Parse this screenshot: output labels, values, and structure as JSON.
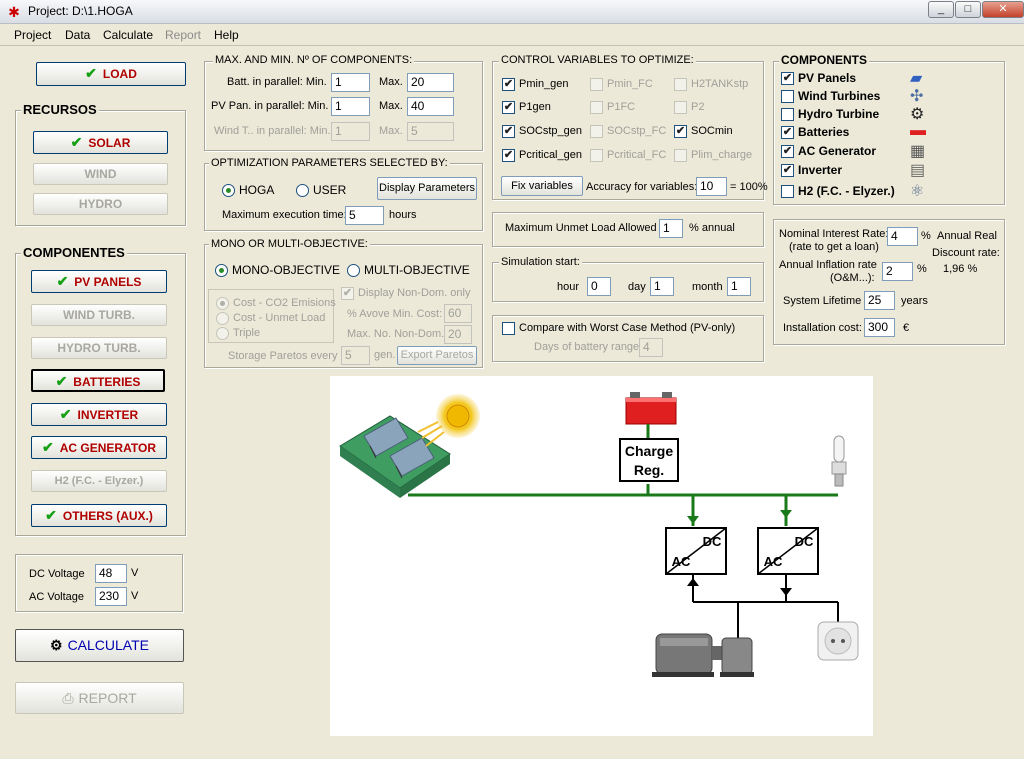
{
  "window": {
    "title": "Project: D:\\1.HOGA",
    "min": "_",
    "max": "□",
    "close": "✕"
  },
  "menu": [
    "Project",
    "Data",
    "Calculate",
    "Report",
    "Help"
  ],
  "left": {
    "load": "LOAD",
    "recursos_title": "RECURSOS",
    "recursos": [
      "SOLAR",
      "WIND",
      "HYDRO"
    ],
    "componentes_title": "COMPONENTES",
    "componentes": [
      "PV PANELS",
      "WIND TURB.",
      "HYDRO TURB.",
      "BATTERIES",
      "INVERTER",
      "AC GENERATOR",
      "H2 (F.C. - Elyzer.)",
      "OTHERS (AUX.)"
    ],
    "dc_voltage_label": "DC Voltage",
    "dc_voltage": "48",
    "dc_unit": "V",
    "ac_voltage_label": "AC Voltage",
    "ac_voltage": "230",
    "ac_unit": "V",
    "calculate": "CALCULATE",
    "report": "REPORT"
  },
  "maxmin": {
    "title": "MAX. AND MIN. Nº OF COMPONENTS:",
    "batt_label": "Batt. in parallel: Min.",
    "batt_min": "1",
    "batt_max": "20",
    "pv_label": "PV Pan. in parallel: Min.",
    "pv_min": "1",
    "pv_max": "40",
    "wind_label": "Wind T.. in parallel: Min.",
    "wind_min": "1",
    "wind_max": "5",
    "max_label": "Max."
  },
  "optim": {
    "title": "OPTIMIZATION PARAMETERS SELECTED BY:",
    "hoga": "HOGA",
    "user": "USER",
    "display_params": "Display Parameters",
    "max_exec_label": "Maximum execution time:",
    "max_exec": "5",
    "hours": "hours"
  },
  "mono": {
    "title": "MONO OR MULTI-OBJECTIVE:",
    "mono": "MONO-OBJECTIVE",
    "multi": "MULTI-OBJECTIVE",
    "opts": [
      "Cost - CO2 Emisions",
      "Cost - Unmet Load",
      "Triple"
    ],
    "display_nondom": "Display Non-Dom. only",
    "avove_label": "% Avove Min. Cost:",
    "avove": "60",
    "maxnondom_label": "Max. No. Non-Dom.:",
    "maxnondom": "20",
    "storage_label": "Storage Paretos every",
    "storage": "5",
    "gen": "gen.",
    "export": "Export Paretos"
  },
  "control": {
    "title": "CONTROL VARIABLES TO OPTIMIZE:",
    "vars": [
      {
        "label": "Pmin_gen",
        "checked": true,
        "enabled": true
      },
      {
        "label": "Pmin_FC",
        "checked": false,
        "enabled": false
      },
      {
        "label": "H2TANKstp",
        "checked": false,
        "enabled": false
      },
      {
        "label": "P1gen",
        "checked": true,
        "enabled": true
      },
      {
        "label": "P1FC",
        "checked": false,
        "enabled": false
      },
      {
        "label": "P2",
        "checked": false,
        "enabled": false
      },
      {
        "label": "SOCstp_gen",
        "checked": true,
        "enabled": true
      },
      {
        "label": "SOCstp_FC",
        "checked": false,
        "enabled": false
      },
      {
        "label": "SOCmin",
        "checked": true,
        "enabled": true
      },
      {
        "label": "Pcritical_gen",
        "checked": true,
        "enabled": true
      },
      {
        "label": "Pcritical_FC",
        "checked": false,
        "enabled": false
      },
      {
        "label": "Plim_charge",
        "checked": false,
        "enabled": false
      }
    ],
    "fix": "Fix variables",
    "accuracy_label": "Accuracy for variables:",
    "accuracy": "10",
    "accuracy_unit": "= 100%"
  },
  "unmet": {
    "label": "Maximum Unmet Load Allowed",
    "value": "1",
    "unit": "% annual"
  },
  "sim": {
    "title": "Simulation start:",
    "hour_label": "hour",
    "hour": "0",
    "day_label": "day",
    "day": "1",
    "month_label": "month",
    "month": "1"
  },
  "compare": {
    "label": "Compare with Worst Case Method (PV-only)",
    "days_label": "Days of battery range",
    "days": "4"
  },
  "components": {
    "title": "COMPONENTS",
    "items": [
      {
        "label": "PV Panels",
        "checked": true
      },
      {
        "label": "Wind Turbines",
        "checked": false
      },
      {
        "label": "Hydro Turbine",
        "checked": false
      },
      {
        "label": "Batteries",
        "checked": true
      },
      {
        "label": "AC Generator",
        "checked": true
      },
      {
        "label": "Inverter",
        "checked": true
      },
      {
        "label": "H2 (F.C. - Elyzer.)",
        "checked": false
      }
    ]
  },
  "finance": {
    "interest_label": "Nominal Interest Rate:",
    "interest_sub": "(rate to get a loan)",
    "interest": "4",
    "pct": "%",
    "annual_real": "Annual Real",
    "discount_label": "Discount rate:",
    "discount": "1,96 %",
    "inflation_label": "Annual Inflation rate",
    "inflation_sub": "(O&M...):",
    "inflation": "2",
    "lifetime_label": "System Lifetime",
    "lifetime": "25",
    "years": "years",
    "install_label": "Installation cost:",
    "install": "300",
    "euro": "€"
  },
  "diagram": {
    "charge_reg": [
      "Charge",
      "Reg."
    ],
    "inv_top": "DC",
    "inv_bottom": "AC",
    "colors": {
      "bus": "#1a7a1a",
      "battery": "#e02020",
      "panel": "#3c8f5a"
    }
  }
}
